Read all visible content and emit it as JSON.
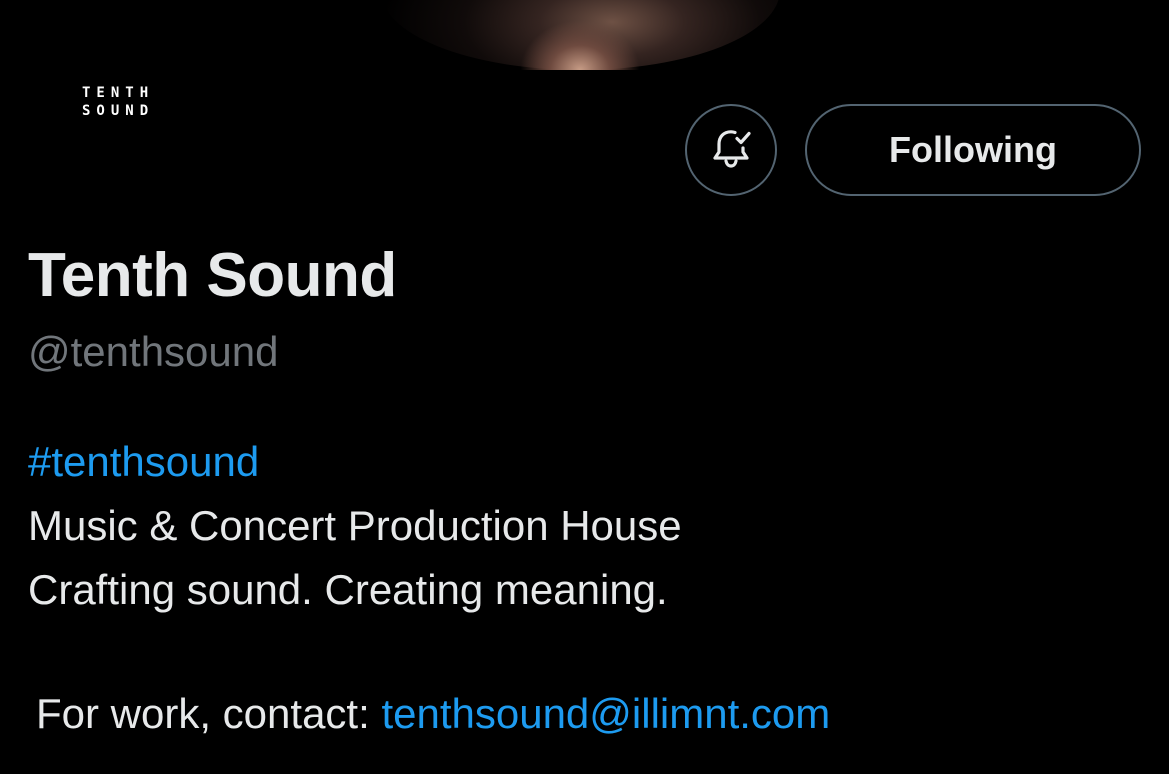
{
  "logo": {
    "line1": "TENTH",
    "line2": "SOUND"
  },
  "actions": {
    "notify_icon": "bell-check-icon",
    "follow_label": "Following"
  },
  "profile": {
    "name": "Tenth Sound",
    "handle": "@tenthsound",
    "bio": {
      "hashtag": "#tenthsound",
      "line1": "Music & Concert Production House",
      "line2": "Crafting sound. Creating meaning."
    },
    "contact": {
      "label": "For work, contact: ",
      "email": "tenthsound@illimnt.com"
    }
  },
  "colors": {
    "background": "#000000",
    "text": "#e7e9ea",
    "muted": "#71767b",
    "link": "#1d9bf0",
    "border": "#536471"
  }
}
